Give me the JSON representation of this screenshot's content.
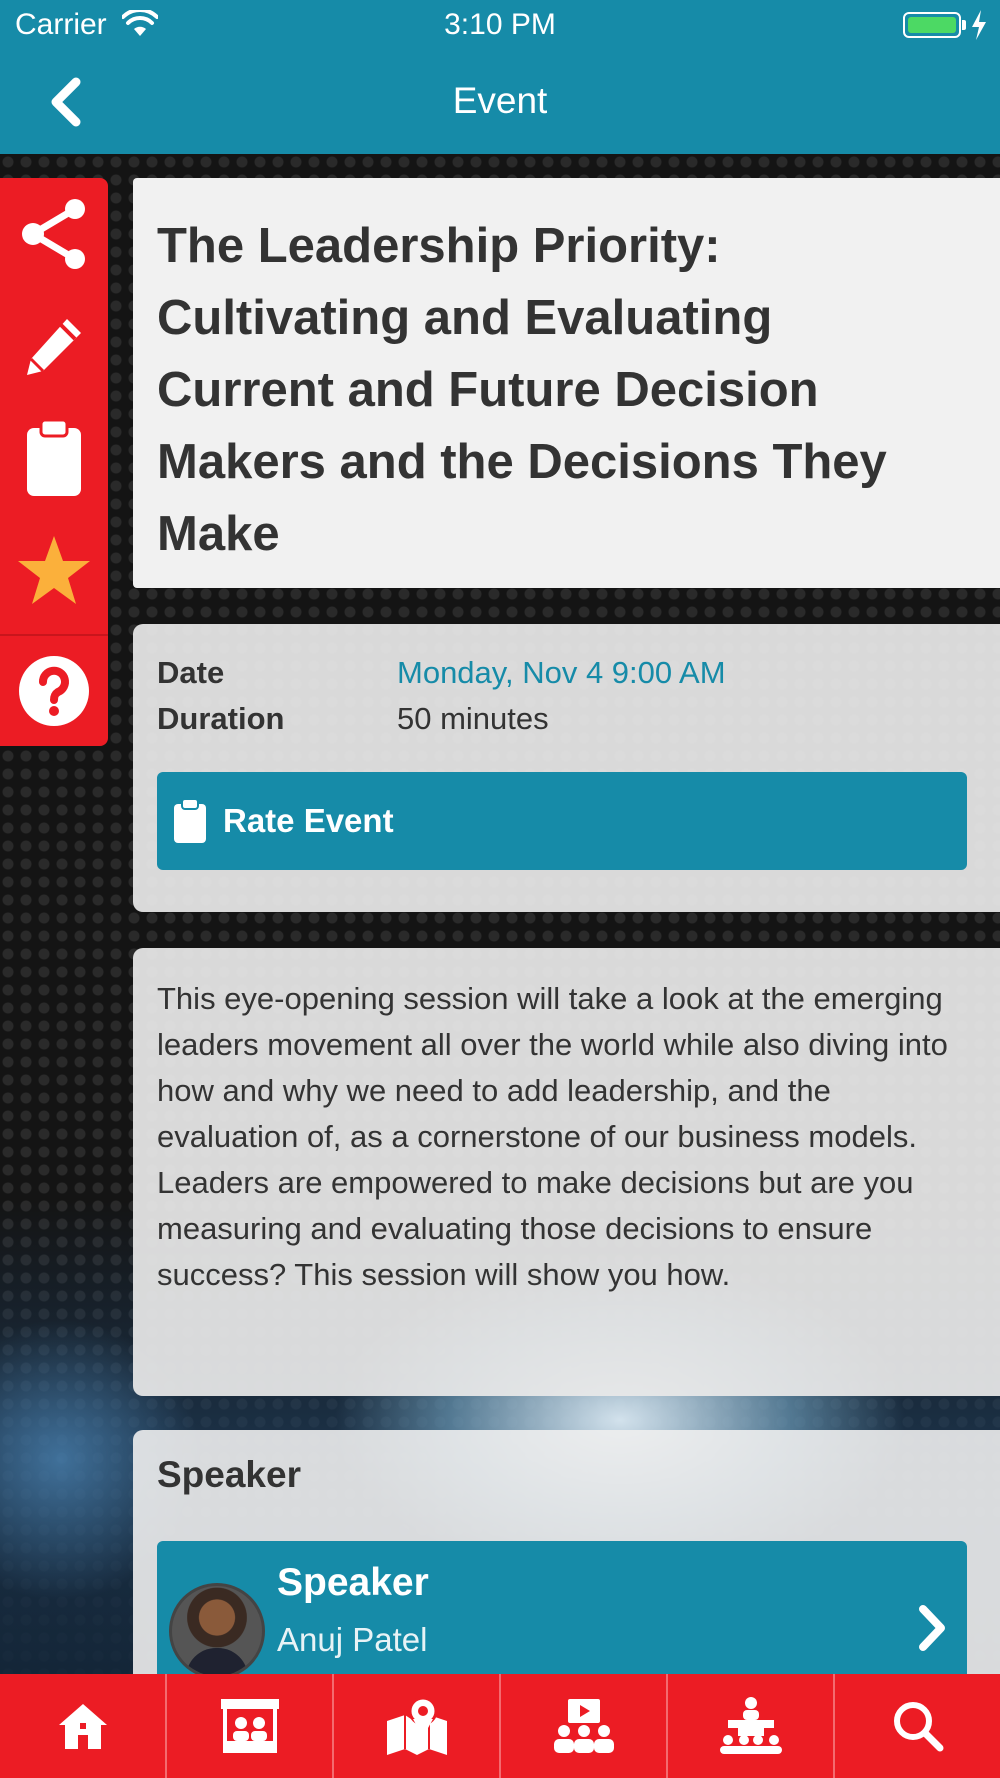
{
  "status_bar": {
    "carrier": "Carrier",
    "time": "3:10 PM"
  },
  "nav": {
    "title": "Event",
    "back_icon": "chevron-left-icon"
  },
  "actions": [
    {
      "icon": "share-icon"
    },
    {
      "icon": "pencil-icon"
    },
    {
      "icon": "clipboard-icon"
    },
    {
      "icon": "star-icon"
    },
    {
      "icon": "help-icon"
    }
  ],
  "event": {
    "title": "The Leadership Priority: Cultivating and Evaluating Current and Future Decision Makers and the Decisions They Make",
    "date_label": "Date",
    "date_value": "Monday, Nov 4 9:00 AM",
    "duration_label": "Duration",
    "duration_value": "50 minutes",
    "rate_button": "Rate Event",
    "description": "This eye-opening session will take a look at the emerging leaders movement all over the world while also diving into how and why we need to add leadership, and the evaluation of, as a cornerstone of our business models. Leaders are empowered to make decisions but are you measuring and evaluating those decisions to ensure success? This session will show you how."
  },
  "speaker": {
    "heading": "Speaker",
    "role": "Speaker",
    "name": "Anuj Patel"
  },
  "tabs": [
    {
      "icon": "home-icon"
    },
    {
      "icon": "exhibitors-booth-icon"
    },
    {
      "icon": "map-icon"
    },
    {
      "icon": "sessions-video-icon"
    },
    {
      "icon": "speakers-podium-icon"
    },
    {
      "icon": "search-icon"
    }
  ],
  "colors": {
    "brand_teal": "#168ba8",
    "brand_red": "#ec1c24",
    "star": "#fbb03b"
  }
}
